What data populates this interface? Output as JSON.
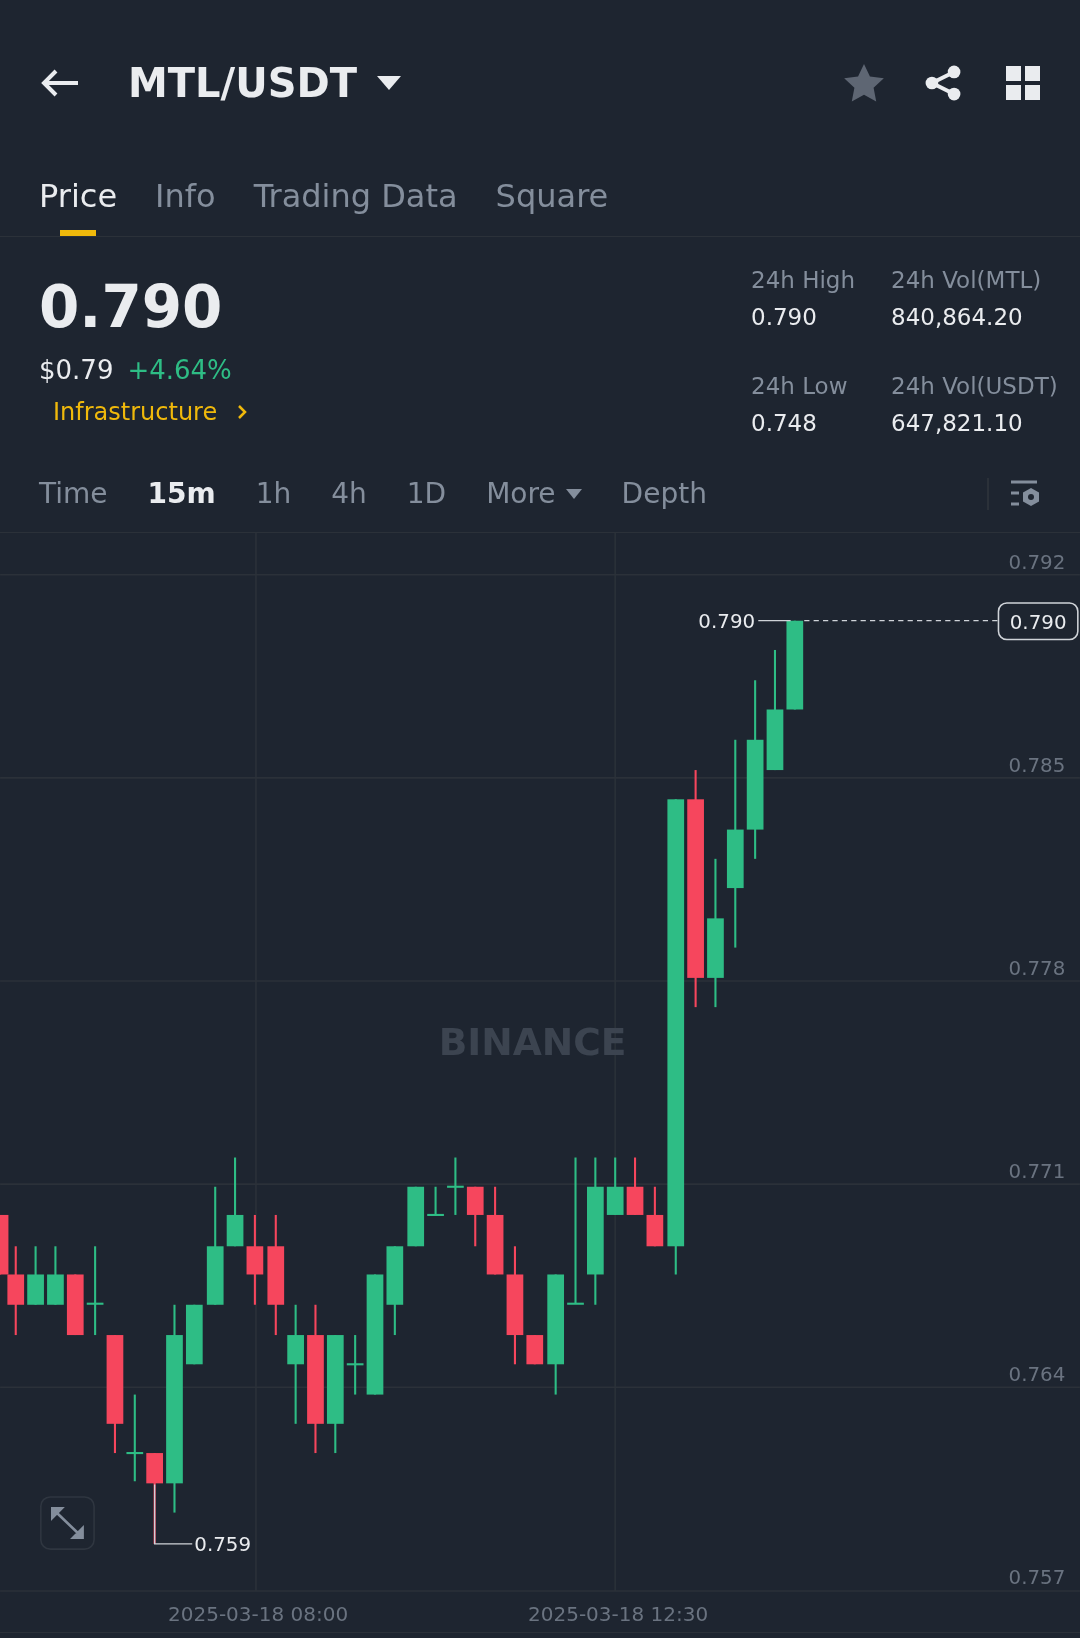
{
  "header": {
    "title": "MTL/USDT",
    "favorite": false
  },
  "tabs": [
    {
      "label": "Price",
      "selected": true
    },
    {
      "label": "Info",
      "selected": false
    },
    {
      "label": "Trading Data",
      "selected": false
    },
    {
      "label": "Square",
      "selected": false
    }
  ],
  "price": {
    "last": "0.790",
    "usd": "$0.79",
    "change": "+4.64%",
    "category": "Infrastructure"
  },
  "stats": [
    {
      "label": "24h High",
      "value": "0.790"
    },
    {
      "label": "24h Vol(MTL)",
      "value": "840,864.20"
    },
    {
      "label": "24h Low",
      "value": "0.748"
    },
    {
      "label": "24h Vol(USDT)",
      "value": "647,821.10"
    }
  ],
  "intervals": [
    {
      "label": "Time",
      "selected": false,
      "kind": "plain"
    },
    {
      "label": "15m",
      "selected": true,
      "kind": "plain"
    },
    {
      "label": "1h",
      "selected": false,
      "kind": "plain"
    },
    {
      "label": "4h",
      "selected": false,
      "kind": "plain"
    },
    {
      "label": "1D",
      "selected": false,
      "kind": "plain"
    },
    {
      "label": "More",
      "selected": false,
      "kind": "dropdown"
    },
    {
      "label": "Depth",
      "selected": false,
      "kind": "plain"
    }
  ],
  "chart": {
    "watermark": "BINANCE",
    "y_labels": [
      "0.792",
      "0.785",
      "0.778",
      "0.771",
      "0.764",
      "0.757"
    ],
    "x_labels": [
      "2025-03-18 08:00",
      "2025-03-18 12:30"
    ],
    "high_marker": "0.790",
    "low_marker": "0.759",
    "current_price": "0.790"
  }
}
